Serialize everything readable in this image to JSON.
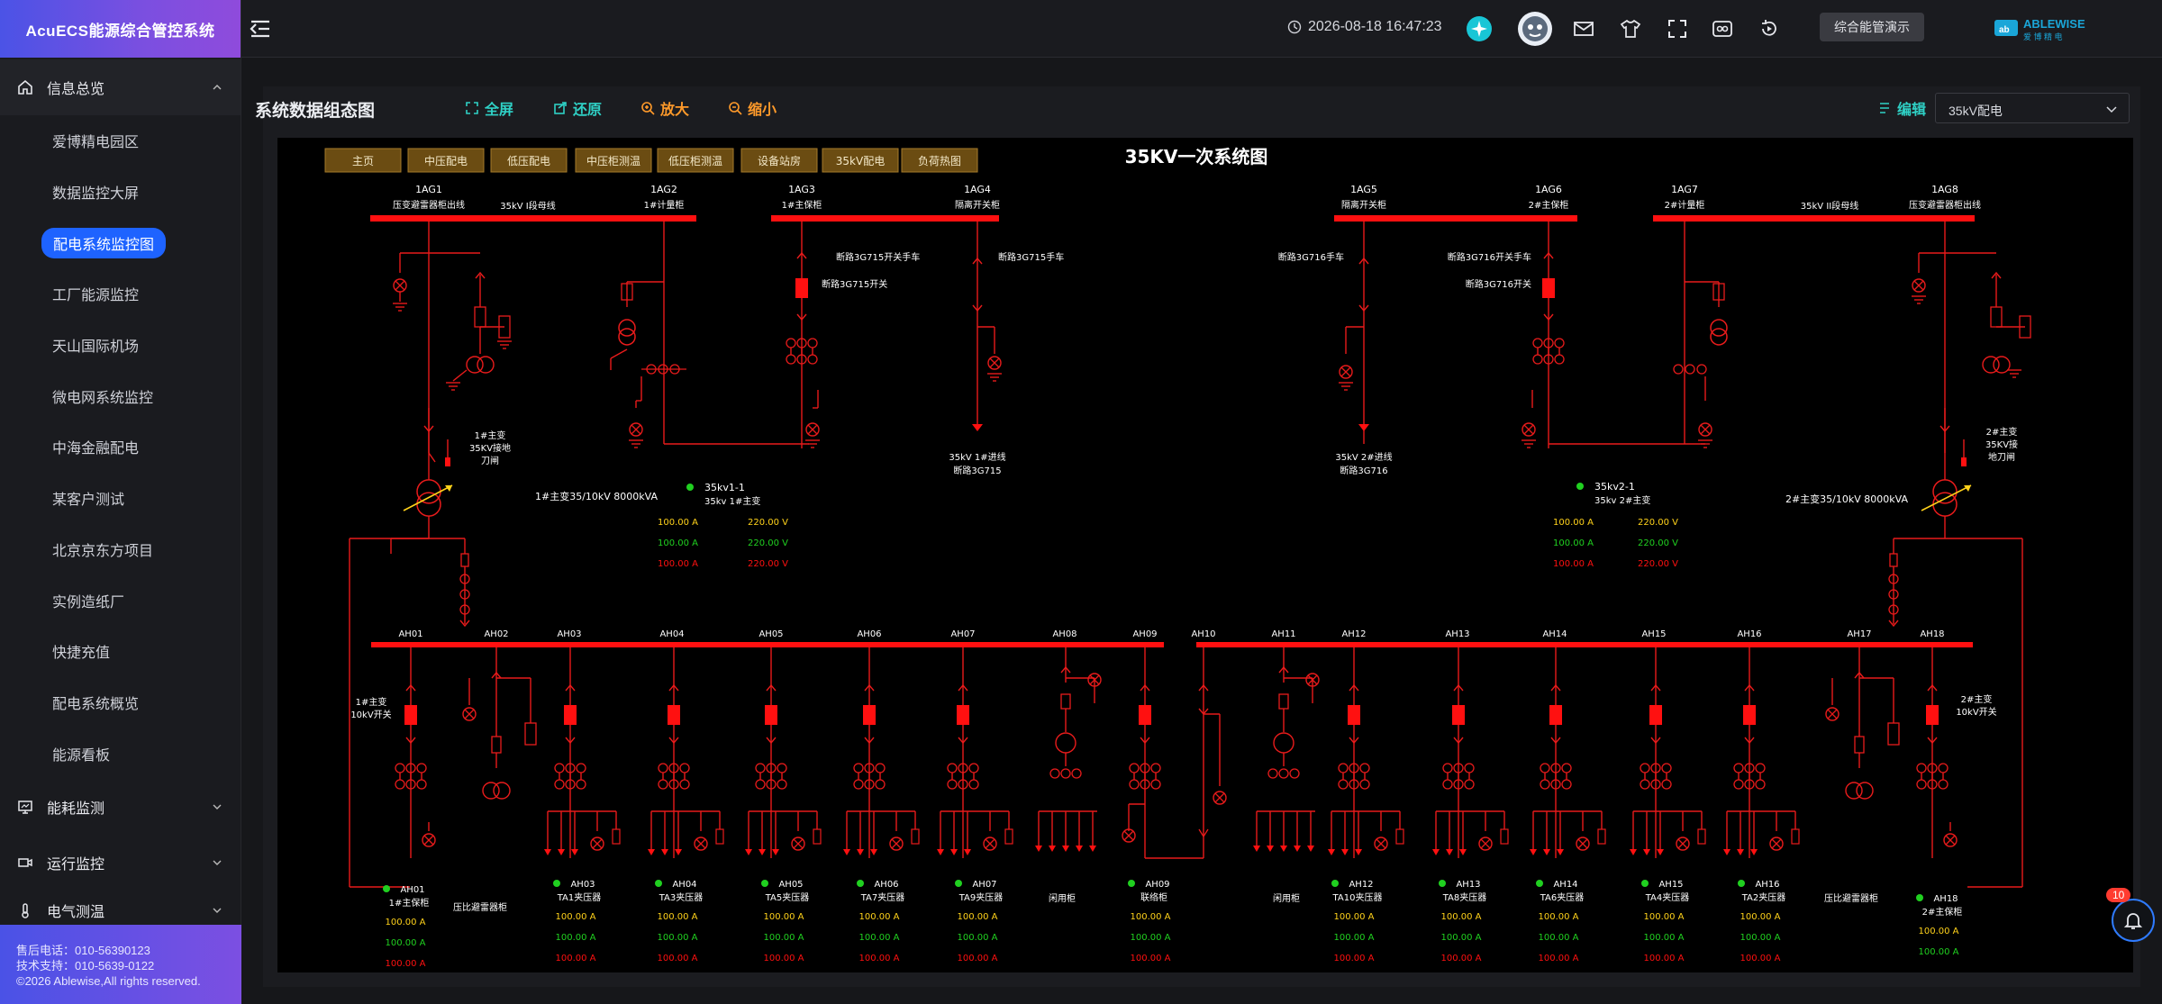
{
  "app": {
    "title": "AcuECS能源综合管控系统"
  },
  "sidebar": {
    "group_info": "信息总览",
    "items": [
      "爱博精电园区",
      "数据监控大屏",
      "配电系统监控图",
      "工厂能源监控",
      "天山国际机场",
      "微电网系统监控",
      "中海金融配电",
      "某客户测试",
      "北京京东方项目",
      "实例造纸厂",
      "快捷充值",
      "配电系统概览",
      "能源看板"
    ],
    "active_index": 2,
    "group_energy": "能耗监测",
    "group_ops": "运行监控",
    "group_elec": "电气测温"
  },
  "support": {
    "line1": "售后电话：010-56390123",
    "line2": "技术支持：010-5639-0122",
    "line3": "©2026 Ablewise,All rights reserved."
  },
  "header": {
    "datetime": "2026-08-18 16:47:23",
    "demo_button": "综合能管演示",
    "logo_text": "ABLEWISE",
    "logo_sub": "爱 博 精 电"
  },
  "toolbar": {
    "title": "系统数据组态图",
    "fullscreen": "全屏",
    "restore": "还原",
    "zoom_in": "放大",
    "zoom_out": "缩小",
    "edit": "编辑",
    "select_value": "35kV配电"
  },
  "diagram": {
    "title": "35KV一次系统图",
    "nav_tabs": [
      "主页",
      "中压配电",
      "低压配电",
      "中压柜测温",
      "低压柜测温",
      "设备站房",
      "35kV配电",
      "负荷热图"
    ],
    "ag_left": [
      {
        "id": "1AG1",
        "desc": "压变避雷器柜出线"
      },
      {
        "id": "1AG2",
        "desc": "1#计量柜"
      },
      {
        "id": "1AG3",
        "desc": "1#主保柜"
      },
      {
        "id": "1AG4",
        "desc": "隔离开关柜"
      }
    ],
    "ag_right": [
      {
        "id": "1AG5",
        "desc": "隔离开关柜"
      },
      {
        "id": "1AG6",
        "desc": "2#主保柜"
      },
      {
        "id": "1AG7",
        "desc": "2#计量柜"
      },
      {
        "id": "1AG8",
        "desc": "压变避雷器柜出线"
      }
    ],
    "bus_left_label": "35kV I段母线",
    "bus_right_label": "35kV II段母线",
    "lbl_3g715_cart": "断路3G715开关手车",
    "lbl_3g715_sw": "断路3G715开关",
    "lbl_3g715_cart2": "断路3G715手车",
    "lbl_3g716_cart": "断路3G716手车",
    "lbl_3g716_cart2": "断路3G716开关手车",
    "lbl_3g716_sw": "断路3G716开关",
    "incoming1": [
      "35kV 1#进线",
      "断路3G715"
    ],
    "incoming2": [
      "35kV 2#进线",
      "断路3G716"
    ],
    "tf1_ground": [
      "1#主变",
      "35KV接地",
      "刀闸"
    ],
    "tf2_ground": [
      "2#主变",
      "35KV接",
      "地刀闸"
    ],
    "tf1": "1#主变35/10kV 8000kVA",
    "tf2": "2#主变35/10kV 8000kVA",
    "meter1": {
      "name": "35kv1-1",
      "sub": "35kv 1#主变",
      "currents": [
        "100.00 A",
        "100.00 A",
        "100.00 A"
      ],
      "voltages": [
        "220.00 V",
        "220.00 V",
        "220.00 V"
      ]
    },
    "meter2": {
      "name": "35kv2-1",
      "sub": "35kv 2#主变",
      "currents": [
        "100.00 A",
        "100.00 A",
        "100.00 A"
      ],
      "voltages": [
        "220.00 V",
        "220.00 V",
        "220.00 V"
      ]
    },
    "ah_labels": [
      "AH01",
      "AH02",
      "AH03",
      "AH04",
      "AH05",
      "AH06",
      "AH07",
      "AH08",
      "AH09",
      "AH10",
      "AH11",
      "AH12",
      "AH13",
      "AH14",
      "AH15",
      "AH16",
      "AH17",
      "AH18"
    ],
    "sw1": [
      "1#主变",
      "10kV开关"
    ],
    "sw2": [
      "2#主变",
      "10kV开关"
    ],
    "bottom": [
      {
        "id": "AH01",
        "name": "1#主保柜",
        "vals": [
          "100.00 A",
          "100.00 A",
          "100.00 A"
        ]
      },
      {
        "id": "",
        "name": "压比避雷器柜",
        "vals": []
      },
      {
        "id": "AH03",
        "name": "TA1夹压器",
        "vals": [
          "100.00 A",
          "100.00 A",
          "100.00 A"
        ]
      },
      {
        "id": "AH04",
        "name": "TA3夹压器",
        "vals": [
          "100.00 A",
          "100.00 A",
          "100.00 A"
        ]
      },
      {
        "id": "AH05",
        "name": "TA5夹压器",
        "vals": [
          "100.00 A",
          "100.00 A",
          "100.00 A"
        ]
      },
      {
        "id": "AH06",
        "name": "TA7夹压器",
        "vals": [
          "100.00 A",
          "100.00 A",
          "100.00 A"
        ]
      },
      {
        "id": "AH07",
        "name": "TA9夹压器",
        "vals": [
          "100.00 A",
          "100.00 A",
          "100.00 A"
        ]
      },
      {
        "id": "",
        "name": "闲用柜",
        "vals": []
      },
      {
        "id": "AH09",
        "name": "联络柜",
        "vals": [
          "100.00 A",
          "100.00 A",
          "100.00 A"
        ]
      },
      {
        "id": "",
        "name": "闲用柜",
        "vals": []
      },
      {
        "id": "AH12",
        "name": "TA10夹压器",
        "vals": [
          "100.00 A",
          "100.00 A",
          "100.00 A"
        ]
      },
      {
        "id": "AH13",
        "name": "TA8夹压器",
        "vals": [
          "100.00 A",
          "100.00 A",
          "100.00 A"
        ]
      },
      {
        "id": "AH14",
        "name": "TA6夹压器",
        "vals": [
          "100.00 A",
          "100.00 A",
          "100.00 A"
        ]
      },
      {
        "id": "AH15",
        "name": "TA4夹压器",
        "vals": [
          "100.00 A",
          "100.00 A",
          "100.00 A"
        ]
      },
      {
        "id": "AH16",
        "name": "TA2夹压器",
        "vals": [
          "100.00 A",
          "100.00 A",
          "100.00 A"
        ]
      },
      {
        "id": "",
        "name": "压比避雷器柜",
        "vals": []
      },
      {
        "id": "AH18",
        "name": "2#主保柜",
        "vals": [
          "100.00 A",
          "100.00 A"
        ]
      }
    ]
  },
  "notifications": {
    "count": "10"
  },
  "colors": {
    "red": "#ff1010",
    "line": "#e81b1b",
    "green": "#20d020",
    "yellow": "#ffd21a",
    "accent": "#1e63ff"
  }
}
